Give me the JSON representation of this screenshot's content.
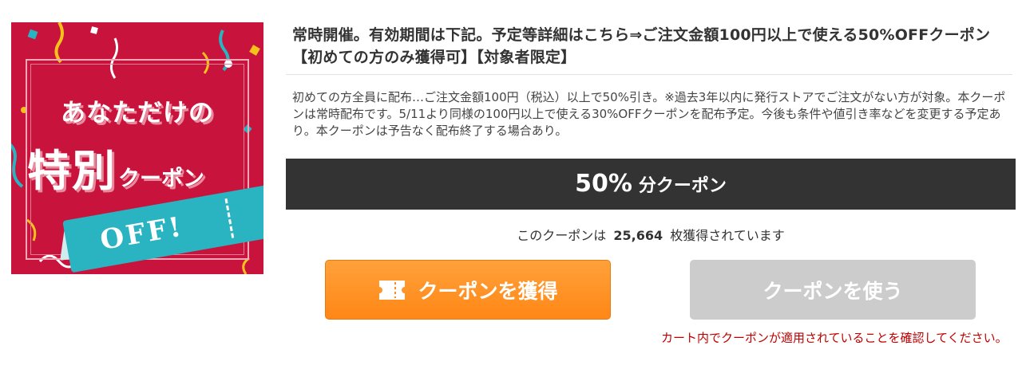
{
  "banner": {
    "line1": "あなただけの",
    "line2_big": "特別",
    "line2_small": "クーポン",
    "ticket_text": "OFF!",
    "colors": {
      "background": "#c8143c",
      "ticket": "#2ab3c0"
    }
  },
  "coupon": {
    "title": "常時開催。有効期間は下記。予定等詳細はこちら⇒ご注文金額100円以上で使える50%OFFクーポン【初めての方のみ獲得可】【対象者限定】",
    "description": "初めての方全員に配布…ご注文金額100円（税込）以上で50%引き。※過去3年以内に発行ストアでご注文がない方が対象。本クーポンは常時配布です。5/11より同様の100円以上で使える30%OFFクーポンを配布予定。今後も条件や値引き率などを変更する予定あり。本クーポンは予告なく配布終了する場合あり。",
    "discount_rate": "50%",
    "discount_unit": "分クーポン",
    "acquired_prefix": "このクーポンは",
    "acquired_count": "25,664",
    "acquired_suffix": "枚獲得されています"
  },
  "buttons": {
    "get_label": "クーポンを獲得",
    "get_icon": "coupon-ticket-icon",
    "use_label": "クーポンを使う",
    "get_color": "#ff8c1a",
    "use_color": "#cccccc"
  },
  "note": "カート内でクーポンが適用されていることを確認してください。",
  "colors": {
    "discount_bar": "#333333",
    "note": "#c00000"
  }
}
